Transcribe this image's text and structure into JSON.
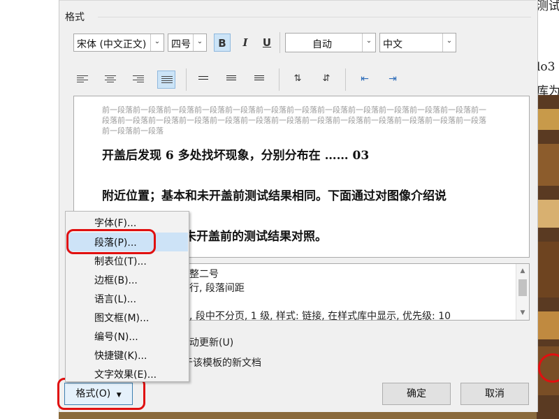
{
  "background_doc": {
    "line1": "测试",
    "line2": "lo3 :",
    "line3": "库为"
  },
  "dialog": {
    "section_label": "格式",
    "font_combo": "宋体 (中文正文)",
    "size_combo": "四号",
    "bold": "B",
    "italic": "I",
    "underline": "U",
    "color_combo": "自动",
    "lang_combo": "中文",
    "preview": {
      "prev_para": "前一段落前一段落前一段落前一段落前一段落前一段落前一段落前一段落前一段落前一段落前一段落前一段落前一段落前一段落前一段落前一段落前一段落前一段落前一段落前一段落前一段落前一段落前一段落前一段落前一段落前一段落前一段落",
      "line1": "开盖后发现          6 多处找坏现象，分别分布在         ……          03",
      "line2": "附近位置；基本和未开盖前测试结果相同。下面通过对图像介绍说",
      "line3": "未开盖前的测试结果对照。"
    },
    "description": {
      "line1": "整二号",
      "line2": "行, 段落间距",
      "line3": ", 段中不分页, 1 级, 样式: 链接, 在样式库中显示, 优先级: 10"
    },
    "auto_update": "动更新(U)",
    "new_docs": "于该模板的新文档",
    "format_button": "格式(O)",
    "ok_button": "确定",
    "cancel_button": "取消"
  },
  "menu": {
    "items": [
      {
        "label": "字体(F)..."
      },
      {
        "label": "段落(P)..."
      },
      {
        "label": "制表位(T)..."
      },
      {
        "label": "边框(B)..."
      },
      {
        "label": "语言(L)..."
      },
      {
        "label": "图文框(M)..."
      },
      {
        "label": "编号(N)..."
      },
      {
        "label": "快捷键(K)..."
      },
      {
        "label": "文字效果(E)..."
      }
    ]
  },
  "colors": {
    "highlight_ring": "#e01010",
    "menu_hover": "#cde3f7",
    "active_toggle": "#cce4f7"
  }
}
